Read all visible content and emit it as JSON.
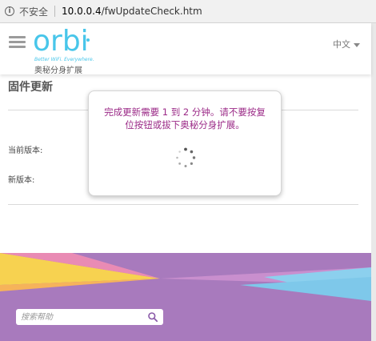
{
  "browser": {
    "security_label": "不安全",
    "url_host": "10.0.0.4",
    "url_path": "/fwUpdateCheck.htm"
  },
  "header": {
    "logo": "orbi",
    "tagline": "Better WiFi. Everywhere.",
    "subbrand": "奥秘分身扩展",
    "language": "中文"
  },
  "page": {
    "title": "固件更新",
    "current_version_label": "当前版本:",
    "new_version_label": "新版本:"
  },
  "modal": {
    "message": "完成更新需要 1 到 2 分钟。请不要按复位按钮或拔下奥秘分身扩展。"
  },
  "footer": {
    "search_placeholder": "搜索帮助"
  },
  "colors": {
    "brand": "#48c6ea",
    "message": "#9b2a87",
    "footer_bg": "#a87abd"
  }
}
